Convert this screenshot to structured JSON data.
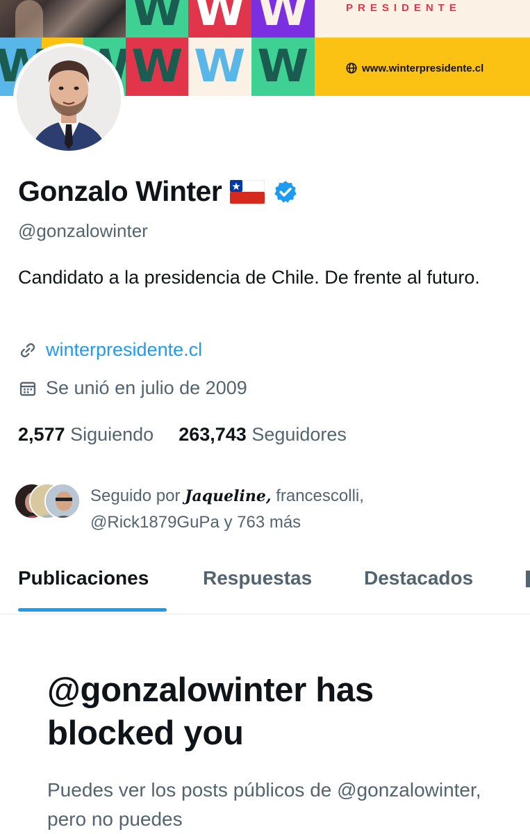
{
  "banner": {
    "tile_letter": "W",
    "presidente_text": "PRESIDENTE",
    "website_text": "www.winterpresidente.cl",
    "colors": {
      "red": "#e0354a",
      "green": "#1f8a5b",
      "mint": "#3ed193",
      "purple": "#7b2fe0",
      "cream": "#fbf1e4",
      "yellow": "#fbc214",
      "skyblue": "#58b6e8",
      "dark_teal": "#1a5c4f"
    }
  },
  "profile": {
    "name": "Gonzalo Winter",
    "flag": "chile-flag-icon",
    "verified": "verified-badge-icon",
    "handle": "@gonzalowinter",
    "bio": "Candidato a la presidencia de Chile. De frente al futuro.",
    "website": "winterpresidente.cl",
    "joined": "Se unió en julio de 2009",
    "following_count": "2,577",
    "following_label": "Siguiendo",
    "followers_count": "263,743",
    "followers_label": "Seguidores",
    "followed_by": {
      "prefix": "Seguido por",
      "name_1": "Jaqueline,",
      "rest": "francescolli,",
      "line_2": "@Rick1879GuPa y 763 más"
    }
  },
  "tabs": [
    {
      "label": "Publicaciones",
      "active": true
    },
    {
      "label": "Respuestas",
      "active": false
    },
    {
      "label": "Destacados",
      "active": false
    }
  ],
  "blocked": {
    "title": "@gonzalowinter has blocked you",
    "description": "Puedes ver los posts públicos de @gonzalowinter, pero no puedes"
  },
  "accent": "#1d9bf0"
}
